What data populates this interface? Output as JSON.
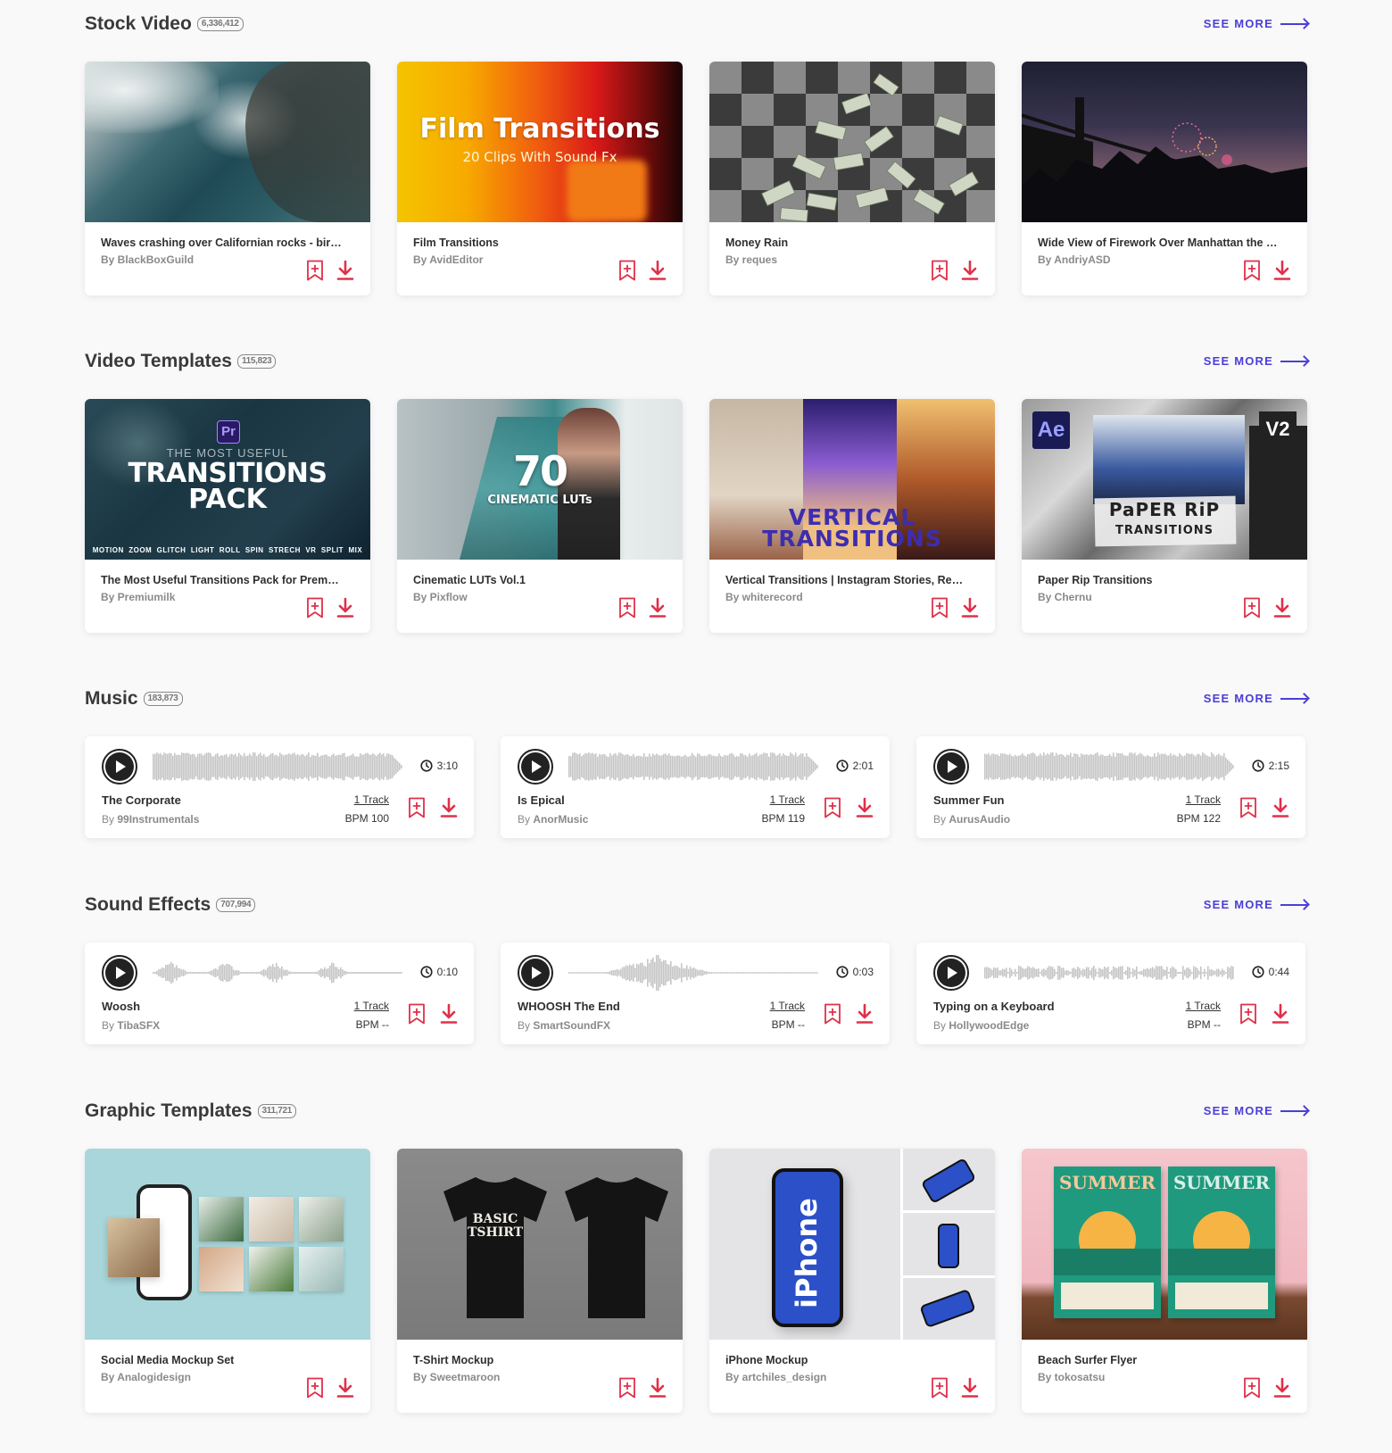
{
  "colors": {
    "accent": "#4b3fd3",
    "action": "#e0304a",
    "background": "#f9f9fa"
  },
  "see_more_label": "SEE MORE",
  "sections": {
    "stock_video": {
      "title": "Stock Video",
      "count": "6,336,412",
      "items": [
        {
          "title": "Waves crashing over Californian rocks - birds-...",
          "author": "By BlackBoxGuild"
        },
        {
          "title": "Film Transitions",
          "author": "By AvidEditor",
          "thumb_title": "Film Transitions",
          "thumb_sub": "20 Clips With Sound Fx"
        },
        {
          "title": "Money Rain",
          "author": "By reques"
        },
        {
          "title": "Wide View of Firework Over Manhattan the S...",
          "author": "By AndriyASD"
        }
      ]
    },
    "video_templates": {
      "title": "Video Templates",
      "count": "115,823",
      "items": [
        {
          "title": "The Most Useful Transitions Pack for Premiere...",
          "author": "By Premiumilk",
          "thumb_badge": "Pr",
          "thumb_small": "THE MOST USEFUL",
          "thumb_big1": "TRANSITIONS",
          "thumb_big2": "PACK",
          "thumb_footer": "MOTION  ZOOM  GLITCH  LIGHT  ROLL  SPIN  STRECH  VR  SPLIT  MIX"
        },
        {
          "title": "Cinematic LUTs Vol.1",
          "author": "By Pixflow",
          "thumb_big": "70",
          "thumb_sub": "CINEMATIC LUTs"
        },
        {
          "title": "Vertical Transitions | Instagram Stories, Reels, ...",
          "author": "By whiterecord",
          "thumb_big1": "VERTICAL",
          "thumb_big2": "TRANSITIONS"
        },
        {
          "title": "Paper Rip Transitions",
          "author": "By Chernu",
          "thumb_badge": "Ae",
          "thumb_badge2": "V2",
          "thumb_big1": "PaPER RiP",
          "thumb_big2": "TRANSITIONS"
        }
      ]
    },
    "music": {
      "title": "Music",
      "count": "183,873",
      "items": [
        {
          "title": "The Corporate",
          "by": "By",
          "author": "99Instrumentals",
          "duration": "3:10",
          "tracks": "1 Track",
          "bpm": "BPM 100"
        },
        {
          "title": "Is Epical",
          "by": "By",
          "author": "AnorMusic",
          "duration": "2:01",
          "tracks": "1 Track",
          "bpm": "BPM 119"
        },
        {
          "title": "Summer Fun",
          "by": "By",
          "author": "AurusAudio",
          "duration": "2:15",
          "tracks": "1 Track",
          "bpm": "BPM 122"
        }
      ]
    },
    "sound_effects": {
      "title": "Sound Effects",
      "count": "707,994",
      "items": [
        {
          "title": "Woosh",
          "by": "By",
          "author": "TibaSFX",
          "duration": "0:10",
          "tracks": "1 Track",
          "bpm": "BPM --"
        },
        {
          "title": "WHOOSH The End",
          "by": "By",
          "author": "SmartSoundFX",
          "duration": "0:03",
          "tracks": "1 Track",
          "bpm": "BPM --"
        },
        {
          "title": "Typing on a Keyboard",
          "by": "By",
          "author": "HollywoodEdge",
          "duration": "0:44",
          "tracks": "1 Track",
          "bpm": "BPM --"
        }
      ]
    },
    "graphic_templates": {
      "title": "Graphic Templates",
      "count": "311,721",
      "items": [
        {
          "title": "Social Media Mockup Set",
          "author": "By Analogidesign"
        },
        {
          "title": "T-Shirt Mockup",
          "author": "By Sweetmaroon",
          "thumb_text1": "BASIC",
          "thumb_text2": "TSHIRT"
        },
        {
          "title": "iPhone Mockup",
          "author": "By artchiles_design",
          "thumb_text": "iPhone"
        },
        {
          "title": "Beach Surfer Flyer",
          "author": "By tokosatsu",
          "thumb_text": "SUMMER"
        }
      ]
    }
  }
}
